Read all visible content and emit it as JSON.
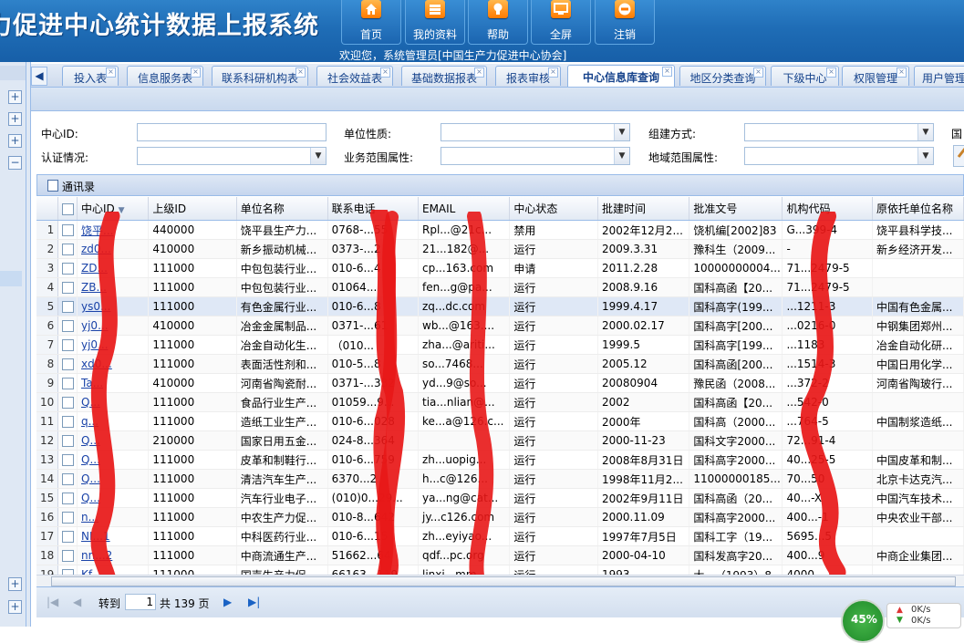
{
  "app": {
    "title": "力促进中心统计数据上报系统",
    "welcome": "欢迎您，系统管理员[中国生产力促进中心协会]"
  },
  "header_buttons": [
    {
      "label": "首页",
      "icon": "home-icon"
    },
    {
      "label": "我的资料",
      "icon": "profile-icon"
    },
    {
      "label": "帮助",
      "icon": "help-bulb-icon"
    },
    {
      "label": "全屏",
      "icon": "fullscreen-monitor-icon"
    },
    {
      "label": "注销",
      "icon": "logout-icon"
    }
  ],
  "tabs": [
    {
      "label": "投入表",
      "active": false
    },
    {
      "label": "信息服务表",
      "active": false
    },
    {
      "label": "联系科研机构表",
      "active": false
    },
    {
      "label": "社会效益表",
      "active": false
    },
    {
      "label": "基础数据报表",
      "active": false
    },
    {
      "label": "报表审核",
      "active": false
    },
    {
      "label": "中心信息库查询",
      "active": true
    },
    {
      "label": "地区分类查询",
      "active": false
    },
    {
      "label": "下级中心",
      "active": false
    },
    {
      "label": "权限管理",
      "active": false
    },
    {
      "label": "用户管理",
      "active": false
    }
  ],
  "form": {
    "center_id_label": "中心ID:",
    "unit_nature_label": "单位性质:",
    "build_mode_label": "组建方式:",
    "cut_label": "国",
    "cert_label": "认证情况:",
    "service_scope_label": "业务范围属性:",
    "region_scope_label": "地域范围属性:"
  },
  "grid": {
    "panel_title": "通讯录",
    "columns": [
      "中心ID",
      "上级ID",
      "单位名称",
      "联系电话",
      "EMAIL",
      "中心状态",
      "批建时间",
      "批准文号",
      "机构代码",
      "原依托单位名称"
    ],
    "rows": [
      [
        "饶平...",
        "440000",
        "饶平县生产力...",
        "0768-...55",
        "Rpl...@21c...",
        "禁用",
        "2002年12月2...",
        "饶机编[2002]83",
        "G...399-4",
        "饶平县科学技..."
      ],
      [
        "zd0...",
        "410000",
        "新乡振动机械...",
        "0373-...2",
        "21...182@...",
        "运行",
        "2009.3.31",
        "豫科生（2009...",
        "-",
        "新乡经济开发..."
      ],
      [
        "ZD...",
        "111000",
        "中包包装行业...",
        "010-6...4",
        "cp...163.com",
        "申请",
        "2011.2.28",
        "10000000004...",
        "71...2479-5",
        ""
      ],
      [
        "ZB...",
        "111000",
        "中包包装行业...",
        "01064...",
        "fen...g@pa...",
        "运行",
        "2008.9.16",
        "国科高函【20...",
        "71...2479-5",
        ""
      ],
      [
        "ys0...",
        "111000",
        "有色金属行业...",
        "010-6...8",
        "zq...dc.com",
        "运行",
        "1999.4.17",
        "国科高字(199...",
        "...1211-3",
        "中国有色金属..."
      ],
      [
        "yj0...",
        "410000",
        "冶金金属制品...",
        "0371-...61",
        "wb...@163....",
        "运行",
        "2000.02.17",
        "国科高字[200...",
        "...0216-0",
        "中钢集团郑州..."
      ],
      [
        "yj0...",
        "111000",
        "冶金自动化生...",
        "（010...",
        "zha...@ariti...",
        "运行",
        "1999.5",
        "国科高字[199...",
        "...1183",
        "冶金自动化研..."
      ],
      [
        "xd0...",
        "111000",
        "表面活性剂和...",
        "010-5...8",
        "so...7468...",
        "运行",
        "2005.12",
        "国科高函[200...",
        "...1514-3",
        "中国日用化学..."
      ],
      [
        "Ta...",
        "410000",
        "河南省陶瓷耐...",
        "0371-...332",
        "yd...9@so...",
        "运行",
        "20080904",
        "豫民函（2008...",
        "...372-2",
        "河南省陶玻行..."
      ],
      [
        "Q...",
        "111000",
        "食品行业生产...",
        "01059...9...",
        "tia...nlian@...",
        "运行",
        "2002",
        "国科高函【20...",
        "...542-0",
        ""
      ],
      [
        "q...",
        "111000",
        "造纸工业生产...",
        "010-6...028",
        "ke...a@126.c...",
        "运行",
        "2000年",
        "国科高（2000...",
        "...764-5",
        "中国制浆造纸..."
      ],
      [
        "Q...",
        "210000",
        "国家日用五金...",
        "024-8...364",
        "",
        "运行",
        "2000-11-23",
        "国科文字2000...",
        "72...91-4",
        ""
      ],
      [
        "Q...",
        "111000",
        "皮革和制鞋行...",
        "010-6...759",
        "zh...uopig...",
        "运行",
        "2008年8月31日",
        "国科高字2000...",
        "40...25-5",
        "中国皮革和制..."
      ],
      [
        "Q...",
        "111000",
        "清洁汽车生产...",
        "6370...2",
        "h...c@126...",
        "运行",
        "1998年11月2...",
        "11000000185...",
        "70...50",
        "北京卡达克汽..."
      ],
      [
        "Q...",
        "111000",
        "汽车行业电子...",
        "(010)0...29...",
        "ya...ng@cat...",
        "运行",
        "2002年9月11日",
        "国科高函（20...",
        "40...-X",
        "中国汽车技术..."
      ],
      [
        "n...",
        "111000",
        "中农生产力促...",
        "010-8...642",
        "jy...c126.com",
        "运行",
        "2000.11.09",
        "国科高字2000...",
        "400...-1",
        "中央农业干部..."
      ],
      [
        "NI...1",
        "111000",
        "中科医药行业...",
        "010-6...15",
        "zh...eyiyao...",
        "运行",
        "1997年7月5日",
        "国科工字（19...",
        "5695...5",
        ""
      ],
      [
        "nn...2",
        "111000",
        "中商流通生产...",
        "51662...64",
        "qdf...pc.org",
        "运行",
        "2000-04-10",
        "国科发高字20...",
        "400...9",
        "中商企业集团..."
      ],
      [
        "Kf...",
        "111000",
        "国声生产力促...",
        "66163...119",
        "linxi...mm",
        "运行",
        "1993...",
        "大...（1993）8...",
        "4000...",
        ""
      ]
    ]
  },
  "pager": {
    "goto_label": "转到",
    "page_value": "1",
    "total_label": "共 139 页"
  },
  "speed_widget": {
    "percent": "45%",
    "up": "0K/s",
    "down": "0K/s"
  },
  "colors": {
    "header_blue": "#1f6db6",
    "accent_orange": "#ff8a00",
    "redaction": "#e81717"
  }
}
